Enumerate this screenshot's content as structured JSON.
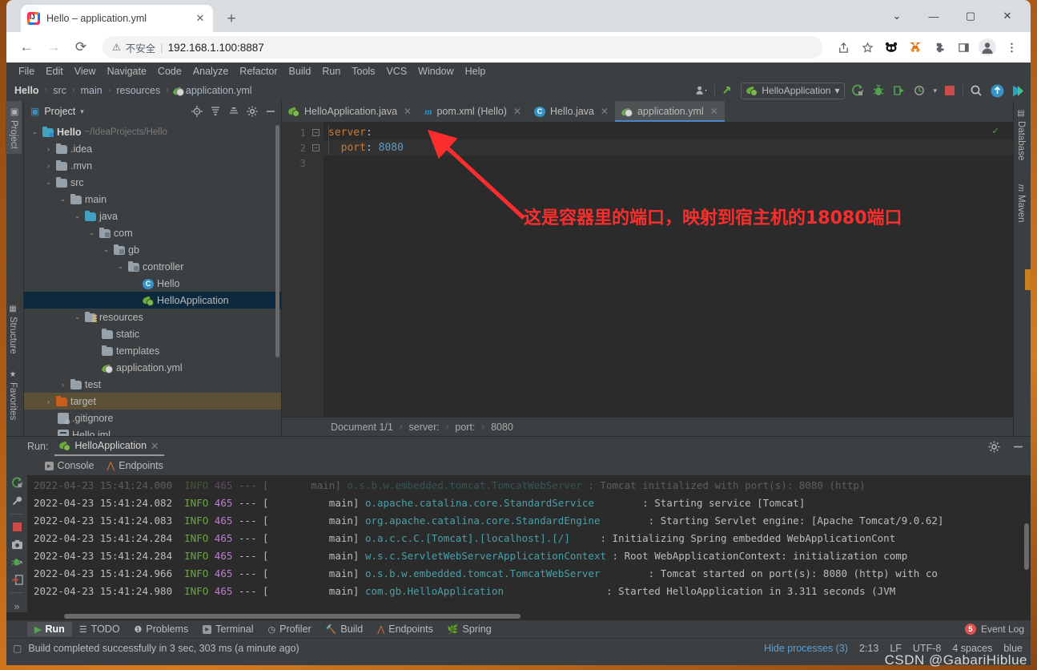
{
  "browser": {
    "tab_title": "Hello – application.yml",
    "tab_close": "✕",
    "new_tab": "+",
    "favicon_name": "intellij-idea-favicon",
    "back": "←",
    "forward": "→",
    "reload": "⟳",
    "security_icon": "⚠",
    "security_text": "不安全",
    "separator": "|",
    "url": "192.168.1.100:8887",
    "window_controls": {
      "more": "⌄",
      "minimize": "—",
      "maximize": "▢",
      "close": "✕"
    },
    "extensions": [
      "share-icon",
      "bookmark-star-icon",
      "panda-extension-icon",
      "metamask-fox-icon",
      "puzzle-extension-icon",
      "sidepanel-icon",
      "profile-avatar-icon",
      "chrome-menu-icon"
    ]
  },
  "ide": {
    "menu": [
      "File",
      "Edit",
      "View",
      "Navigate",
      "Code",
      "Analyze",
      "Refactor",
      "Build",
      "Run",
      "Tools",
      "VCS",
      "Window",
      "Help"
    ],
    "navbar": {
      "crumbs": [
        "Hello",
        "src",
        "main",
        "resources",
        "application.yml"
      ],
      "separator": "›",
      "run_config": "HelloApplication",
      "dropdown_caret": "▾",
      "icons": [
        "user-avatar-icon",
        "updates-arrow-icon",
        "run-icon",
        "debug-icon",
        "run-with-coverage-icon",
        "profile-icon",
        "stop-icon",
        "search-everywhere-icon",
        "update-project-icon",
        "idea-logo-icon"
      ]
    },
    "left_tabs": [
      {
        "label": "Project",
        "icon": "project-icon",
        "active": true
      },
      {
        "label": "Structure",
        "icon": "structure-icon",
        "active": false
      },
      {
        "label": "Favorites",
        "icon": "favorites-star-icon",
        "active": false
      }
    ],
    "right_tabs": [
      {
        "label": "Database",
        "icon": "database-icon"
      },
      {
        "label": "Maven",
        "icon": "maven-icon"
      }
    ],
    "project": {
      "title": "Project",
      "caret": "▾",
      "header_icons": [
        "locate-icon",
        "expand-all-icon",
        "collapse-all-icon",
        "settings-gear-icon",
        "hide-icon"
      ],
      "tree": [
        {
          "indent": 0,
          "arrow": "⌄",
          "icon": "module-folder-icon",
          "label": "Hello",
          "path": "~/IdeaProjects/Hello",
          "bold": true,
          "state": ""
        },
        {
          "indent": 1,
          "arrow": "›",
          "icon": "folder-icon",
          "label": ".idea",
          "path": "",
          "bold": false,
          "state": ""
        },
        {
          "indent": 1,
          "arrow": "›",
          "icon": "folder-icon",
          "label": ".mvn",
          "path": "",
          "bold": false,
          "state": ""
        },
        {
          "indent": 1,
          "arrow": "⌄",
          "icon": "folder-icon",
          "label": "src",
          "path": "",
          "bold": false,
          "state": ""
        },
        {
          "indent": 2,
          "arrow": "⌄",
          "icon": "folder-icon",
          "label": "main",
          "path": "",
          "bold": false,
          "state": ""
        },
        {
          "indent": 3,
          "arrow": "⌄",
          "icon": "source-folder-icon",
          "label": "java",
          "path": "",
          "bold": false,
          "state": ""
        },
        {
          "indent": 4,
          "arrow": "⌄",
          "icon": "package-icon",
          "label": "com",
          "path": "",
          "bold": false,
          "state": ""
        },
        {
          "indent": 5,
          "arrow": "⌄",
          "icon": "package-icon",
          "label": "gb",
          "path": "",
          "bold": false,
          "state": ""
        },
        {
          "indent": 6,
          "arrow": "⌄",
          "icon": "package-icon",
          "label": "controller",
          "path": "",
          "bold": false,
          "state": ""
        },
        {
          "indent": 7,
          "arrow": "",
          "icon": "java-class-icon",
          "label": "Hello",
          "path": "",
          "bold": false,
          "state": ""
        },
        {
          "indent": 7,
          "arrow": "",
          "icon": "spring-boot-class-icon",
          "label": "HelloApplication",
          "path": "",
          "bold": false,
          "state": "selected"
        },
        {
          "indent": 3,
          "arrow": "⌄",
          "icon": "resources-folder-icon",
          "label": "resources",
          "path": "",
          "bold": false,
          "state": ""
        },
        {
          "indent": 4,
          "arrow": "",
          "icon": "folder-icon",
          "label": "static",
          "path": "",
          "bold": false,
          "state": ""
        },
        {
          "indent": 4,
          "arrow": "",
          "icon": "folder-icon",
          "label": "templates",
          "path": "",
          "bold": false,
          "state": ""
        },
        {
          "indent": 4,
          "arrow": "",
          "icon": "spring-yaml-icon",
          "label": "application.yml",
          "path": "",
          "bold": false,
          "state": ""
        },
        {
          "indent": 2,
          "arrow": "›",
          "icon": "folder-icon",
          "label": "test",
          "path": "",
          "bold": false,
          "state": ""
        },
        {
          "indent": 1,
          "arrow": "›",
          "icon": "excluded-folder-icon",
          "label": "target",
          "path": "",
          "bold": false,
          "state": "highlight"
        },
        {
          "indent": 1,
          "arrow": "",
          "icon": "gitignore-icon",
          "label": ".gitignore",
          "path": "",
          "bold": false,
          "state": ""
        },
        {
          "indent": 1,
          "arrow": "",
          "icon": "iml-file-icon",
          "label": "Hello.iml",
          "path": "",
          "bold": false,
          "state": ""
        }
      ]
    },
    "editor": {
      "tabs": [
        {
          "label": "HelloApplication.java",
          "icon": "spring-boot-class-icon",
          "active": false,
          "close": "✕"
        },
        {
          "label": "pom.xml (Hello)",
          "icon": "maven-m-icon",
          "active": false,
          "close": "✕"
        },
        {
          "label": "Hello.java",
          "icon": "java-class-icon",
          "active": false,
          "close": "✕"
        },
        {
          "label": "application.yml",
          "icon": "spring-yaml-icon",
          "active": true,
          "close": "✕"
        }
      ],
      "line_numbers": [
        "1",
        "2",
        "3"
      ],
      "code": [
        {
          "key": "server",
          "colon": ":",
          "value": "",
          "indent": 0
        },
        {
          "key": "port",
          "colon": ":",
          "value": "8080",
          "indent": 1
        }
      ],
      "inspection_ok": "✓",
      "annotation_text": "这是容器里的端口，映射到宿主机的18080端口",
      "breadcrumb": [
        "Document 1/1",
        "server:",
        "port:",
        "8080"
      ],
      "breadcrumb_separator": "›"
    },
    "run_window": {
      "label": "Run:",
      "tab": "HelloApplication",
      "tab_close": "✕",
      "icons": [
        "settings-gear-icon",
        "hide-window-icon"
      ],
      "subtabs": [
        {
          "label": "Console",
          "icon": "console-icon"
        },
        {
          "label": "Endpoints",
          "icon": "endpoints-icon"
        }
      ],
      "toolbar_icons": [
        "rerun-icon",
        "wrench-icon",
        "stop-icon",
        "screenshot-camera-icon",
        "thread-dump-icon",
        "exit-icon",
        "expand-more-icon"
      ],
      "logs": [
        {
          "time": "2022-04-23 15:41:24.000",
          "level": "INFO",
          "pid": "465",
          "dash": "---",
          "thread": "main]",
          "logger": "o.s.b.w.embedded.tomcat.TomcatWebServer",
          "msg": "Tomcat initialized with port(s): 8080 (http)",
          "partial": true
        },
        {
          "time": "2022-04-23 15:41:24.082",
          "level": "INFO",
          "pid": "465",
          "dash": "---",
          "thread": "main]",
          "logger": "o.apache.catalina.core.StandardService",
          "msg": "Starting service [Tomcat]",
          "partial": false
        },
        {
          "time": "2022-04-23 15:41:24.083",
          "level": "INFO",
          "pid": "465",
          "dash": "---",
          "thread": "main]",
          "logger": "org.apache.catalina.core.StandardEngine",
          "msg": "Starting Servlet engine: [Apache Tomcat/9.0.62]",
          "partial": false
        },
        {
          "time": "2022-04-23 15:41:24.284",
          "level": "INFO",
          "pid": "465",
          "dash": "---",
          "thread": "main]",
          "logger": "o.a.c.c.C.[Tomcat].[localhost].[/]",
          "msg": "Initializing Spring embedded WebApplicationCont",
          "partial": false
        },
        {
          "time": "2022-04-23 15:41:24.284",
          "level": "INFO",
          "pid": "465",
          "dash": "---",
          "thread": "main]",
          "logger": "w.s.c.ServletWebServerApplicationContext",
          "msg": "Root WebApplicationContext: initialization comp",
          "partial": false
        },
        {
          "time": "2022-04-23 15:41:24.966",
          "level": "INFO",
          "pid": "465",
          "dash": "---",
          "thread": "main]",
          "logger": "o.s.b.w.embedded.tomcat.TomcatWebServer",
          "msg": "Tomcat started on port(s): 8080 (http) with co",
          "partial": false
        },
        {
          "time": "2022-04-23 15:41:24.980",
          "level": "INFO",
          "pid": "465",
          "dash": "---",
          "thread": "main]",
          "logger": "com.gb.HelloApplication",
          "msg": "Started HelloApplication in 3.311 seconds (JVM",
          "partial": false
        }
      ]
    },
    "bottom_bar": {
      "items": [
        {
          "label": "Run",
          "icon": "run-play-icon",
          "active": true
        },
        {
          "label": "TODO",
          "icon": "todo-list-icon",
          "active": false
        },
        {
          "label": "Problems",
          "icon": "problems-icon",
          "active": false
        },
        {
          "label": "Terminal",
          "icon": "terminal-icon",
          "active": false
        },
        {
          "label": "Profiler",
          "icon": "profiler-icon",
          "active": false
        },
        {
          "label": "Build",
          "icon": "build-hammer-icon",
          "active": false
        },
        {
          "label": "Endpoints",
          "icon": "endpoints-icon",
          "active": false
        },
        {
          "label": "Spring",
          "icon": "spring-leaf-icon",
          "active": false
        }
      ],
      "event_log": "Event Log",
      "event_badge": "5"
    },
    "status_bar": {
      "icon": "status-file-icon",
      "message": "Build completed successfully in 3 sec, 303 ms (a minute ago)",
      "hide_processes": "Hide processes (3)",
      "caret_position": "2:13",
      "line_separator": "LF",
      "encoding": "UTF-8",
      "indent": "4 spaces",
      "branch": "blue",
      "watermark": "CSDN @GabariHiblue"
    }
  },
  "colors": {
    "ide_bg": "#3c3f41",
    "editor_bg": "#2b2b2b",
    "accent_blue": "#4a88c7",
    "selection_blue": "#0d293e",
    "annotation_red": "#fc2d2d",
    "yaml_key": "#cc7832",
    "yaml_value": "#6897bb",
    "log_info_green": "#6aab3d",
    "log_pid_purple": "#bb7fce",
    "log_logger_teal": "#49a0a8"
  }
}
